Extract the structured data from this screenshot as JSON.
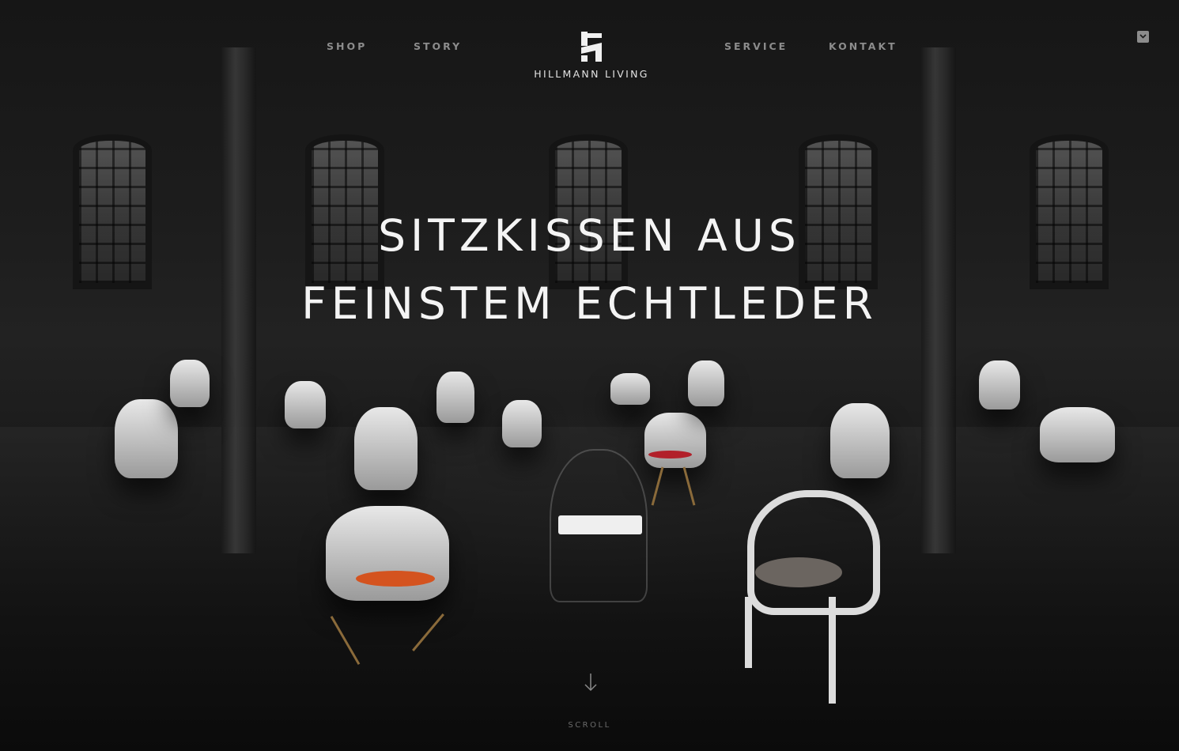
{
  "nav": {
    "left": [
      {
        "label": "SHOP"
      },
      {
        "label": "STORY"
      }
    ],
    "right": [
      {
        "label": "SERVICE"
      },
      {
        "label": "KONTAKT"
      }
    ]
  },
  "brand": {
    "name": "HILLMANN LIVING",
    "logo_icon": "hillmann-logo-mark"
  },
  "cart": {
    "icon": "cart-icon"
  },
  "hero": {
    "headline_line1": "SITZKISSEN AUS",
    "headline_line2": "FEINSTEM ECHTLEDER",
    "background": "dark industrial hall with white designer chairs and leather seat cushions"
  },
  "scroll": {
    "label": "SCROLL",
    "icon": "arrow-down-icon"
  },
  "colors": {
    "nav_text": "#8c8c8c",
    "headline_text": "#f4f4f4",
    "background": "#0b0b0b",
    "cushion_orange": "#d4531f",
    "cushion_red": "#b2202a",
    "cushion_grey": "#6b6560"
  }
}
